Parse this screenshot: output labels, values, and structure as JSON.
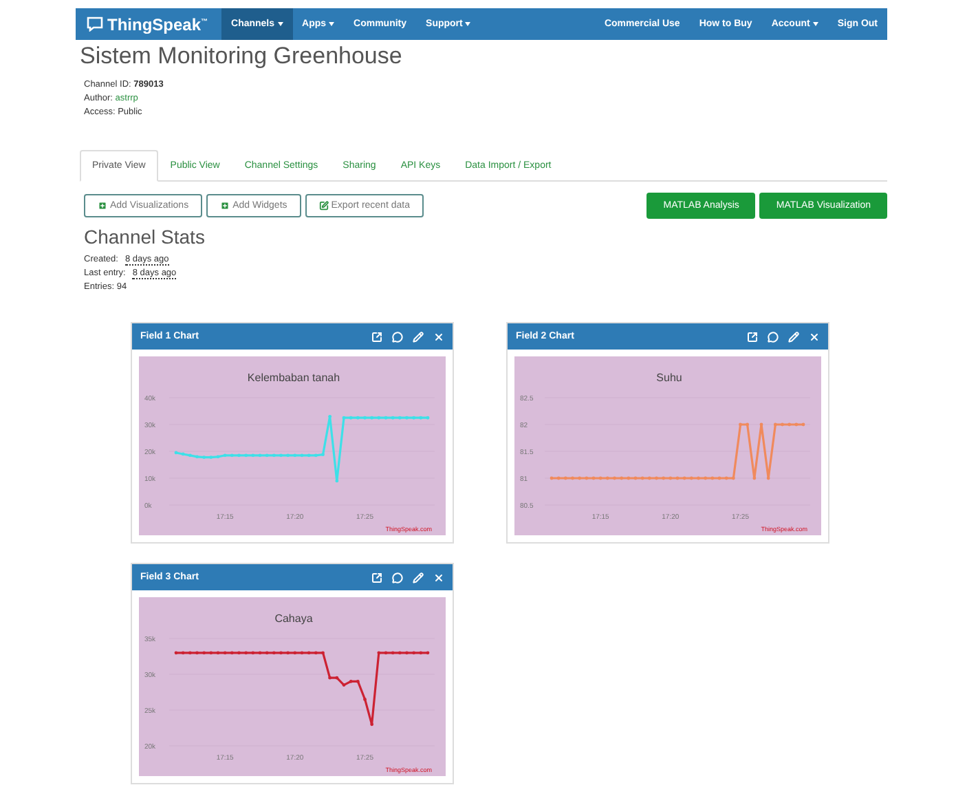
{
  "navbar": {
    "brand": "ThingSpeak$^{™}$",
    "left_items": [
      {
        "label": "Channels",
        "dropdown": true,
        "selected": true
      },
      {
        "label": "Apps",
        "dropdown": true,
        "selected": false
      },
      {
        "label": "Community",
        "dropdown": false,
        "selected": false
      },
      {
        "label": "Support",
        "dropdown": true,
        "selected": false
      }
    ],
    "right_items": [
      {
        "label": "Commercial Use",
        "dropdown": false,
        "selected": false
      },
      {
        "label": "How to Buy",
        "dropdown": false,
        "selected": false
      },
      {
        "label": "Account",
        "dropdown": true,
        "selected": false
      },
      {
        "label": "Sign Out",
        "dropdown": false,
        "selected": false
      }
    ]
  },
  "channel": {
    "title": "Sistem Monitoring Greenhouse",
    "meta": [
      {
        "label": "Channel ID:",
        "value": "789013",
        "kind": "bold"
      },
      {
        "label": "Author:",
        "value": "astrrp",
        "kind": "link"
      },
      {
        "label": "Access:",
        "value": "Public",
        "kind": "plain"
      }
    ]
  },
  "tabs": [
    {
      "label": "Private View",
      "selected": true
    },
    {
      "label": "Public View",
      "selected": false
    },
    {
      "label": "Channel Settings",
      "selected": false
    },
    {
      "label": "Sharing",
      "selected": false
    },
    {
      "label": "API Keys",
      "selected": false
    },
    {
      "label": "Data Import / Export",
      "selected": false
    }
  ],
  "actions": [
    {
      "label": "Add Visualizations",
      "kind": "plus"
    },
    {
      "label": "Add Widgets",
      "kind": "plus"
    },
    {
      "label": "Export recent data",
      "kind": "export"
    }
  ],
  "matlab_buttons": [
    "MATLAB Analysis",
    "MATLAB Visualization"
  ],
  "stats": {
    "title": "Channel Stats",
    "items": [
      {
        "label": "Created:",
        "value": "8 days ago",
        "kind": "time"
      },
      {
        "label": "Last entry:",
        "value": "8 days ago",
        "kind": "time"
      },
      {
        "label": "Entries:",
        "value": "94",
        "kind": "plain"
      }
    ]
  },
  "charts": [
    {
      "header": "Field 1 Chart",
      "credit": "ThingSpeak.com",
      "chart_data": {
        "type": "line",
        "grid": true,
        "title": "Kelembaban tanah",
        "ylim": [
          0,
          40000
        ],
        "yticks": [
          {
            "value": 0,
            "label": "0k"
          },
          {
            "value": 10000,
            "label": "10k"
          },
          {
            "value": 20000,
            "label": "20k"
          },
          {
            "value": 30000,
            "label": "30k"
          },
          {
            "value": 40000,
            "label": "40k"
          }
        ],
        "categories": [
          null,
          null,
          null,
          null,
          null,
          null,
          null,
          "17:15",
          null,
          null,
          null,
          null,
          null,
          null,
          null,
          null,
          null,
          "17:20",
          null,
          null,
          null,
          null,
          null,
          null,
          null,
          null,
          null,
          "17:25",
          null,
          null,
          null,
          null,
          null,
          null,
          null,
          null,
          null
        ],
        "series": [
          {
            "color": "#3ee0e8",
            "values": [
              19500,
              19000,
              18500,
              18000,
              17800,
              17800,
              18000,
              18500,
              18500,
              18500,
              18500,
              18500,
              18500,
              18500,
              18500,
              18500,
              18500,
              18500,
              18500,
              18500,
              18500,
              18800,
              33000,
              9000,
              32500,
              32500,
              32500,
              32500,
              32500,
              32500,
              32500,
              32500,
              32500,
              32500,
              32500,
              32500,
              32500
            ]
          }
        ]
      }
    },
    {
      "header": "Field 2 Chart",
      "credit": "ThingSpeak.com",
      "chart_data": {
        "type": "line",
        "grid": true,
        "title": "Suhu",
        "ylim": [
          80.5,
          82.5
        ],
        "yticks": [
          80.5,
          81,
          81.5,
          82,
          82.5
        ],
        "categories": [
          null,
          null,
          null,
          null,
          null,
          null,
          null,
          "17:15",
          null,
          null,
          null,
          null,
          null,
          null,
          null,
          null,
          null,
          "17:20",
          null,
          null,
          null,
          null,
          null,
          null,
          null,
          null,
          null,
          "17:25",
          null,
          null,
          null,
          null,
          null,
          null,
          null,
          null,
          null
        ],
        "series": [
          {
            "color": "#f08a5d",
            "values": [
              81,
              81,
              81,
              81,
              81,
              81,
              81,
              81,
              81,
              81,
              81,
              81,
              81,
              81,
              81,
              81,
              81,
              81,
              81,
              81,
              81,
              81,
              81,
              81,
              81,
              81,
              81,
              82,
              82,
              81,
              82,
              81,
              82,
              82,
              82,
              82,
              82
            ]
          }
        ]
      }
    },
    {
      "header": "Field 3 Chart",
      "credit": "ThingSpeak.com",
      "chart_data": {
        "type": "line",
        "grid": true,
        "title": "Cahaya",
        "ylim": [
          20000,
          35000
        ],
        "yticks": [
          {
            "value": 20000,
            "label": "20k"
          },
          {
            "value": 25000,
            "label": "25k"
          },
          {
            "value": 30000,
            "label": "30k"
          },
          {
            "value": 35000,
            "label": "35k"
          }
        ],
        "categories": [
          null,
          null,
          null,
          null,
          null,
          null,
          null,
          "17:15",
          null,
          null,
          null,
          null,
          null,
          null,
          null,
          null,
          null,
          "17:20",
          null,
          null,
          null,
          null,
          null,
          null,
          null,
          null,
          null,
          "17:25",
          null,
          null,
          null,
          null,
          null,
          null,
          null,
          null,
          null
        ],
        "series": [
          {
            "color": "#cc2233",
            "values": [
              33000,
              33000,
              33000,
              33000,
              33000,
              33000,
              33000,
              33000,
              33000,
              33000,
              33000,
              33000,
              33000,
              33000,
              33000,
              33000,
              33000,
              33000,
              33000,
              33000,
              33000,
              33000,
              29500,
              29500,
              28500,
              29000,
              29000,
              26500,
              23000,
              33000,
              33000,
              33000,
              33000,
              33000,
              33000,
              33000,
              33000
            ]
          }
        ]
      }
    }
  ]
}
